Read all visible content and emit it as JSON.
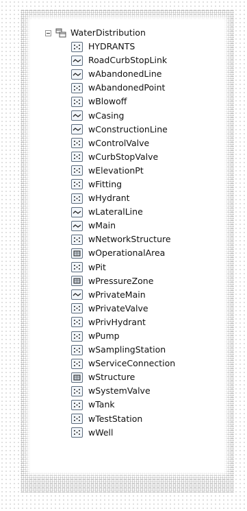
{
  "tree": {
    "root": {
      "label": "WaterDistribution",
      "expanded": true,
      "icon": "feature-dataset-icon"
    },
    "items": [
      {
        "label": "HYDRANTS",
        "icon": "point"
      },
      {
        "label": "RoadCurbStopLink",
        "icon": "line"
      },
      {
        "label": "wAbandonedLine",
        "icon": "line"
      },
      {
        "label": "wAbandonedPoint",
        "icon": "point"
      },
      {
        "label": "wBlowoff",
        "icon": "point"
      },
      {
        "label": "wCasing",
        "icon": "line"
      },
      {
        "label": "wConstructionLine",
        "icon": "line"
      },
      {
        "label": "wControlValve",
        "icon": "point"
      },
      {
        "label": "wCurbStopValve",
        "icon": "point"
      },
      {
        "label": "wElevationPt",
        "icon": "point"
      },
      {
        "label": "wFitting",
        "icon": "point"
      },
      {
        "label": "wHydrant",
        "icon": "point"
      },
      {
        "label": "wLateralLine",
        "icon": "line"
      },
      {
        "label": "wMain",
        "icon": "line"
      },
      {
        "label": "wNetworkStructure",
        "icon": "point"
      },
      {
        "label": "wOperationalArea",
        "icon": "polygon"
      },
      {
        "label": "wPit",
        "icon": "point"
      },
      {
        "label": "wPressureZone",
        "icon": "polygon"
      },
      {
        "label": "wPrivateMain",
        "icon": "line"
      },
      {
        "label": "wPrivateValve",
        "icon": "point"
      },
      {
        "label": "wPrivHydrant",
        "icon": "point"
      },
      {
        "label": "wPump",
        "icon": "point"
      },
      {
        "label": "wSamplingStation",
        "icon": "point"
      },
      {
        "label": "wServiceConnection",
        "icon": "point"
      },
      {
        "label": "wStructure",
        "icon": "polygon"
      },
      {
        "label": "wSystemValve",
        "icon": "point"
      },
      {
        "label": "wTank",
        "icon": "point"
      },
      {
        "label": "wTestStation",
        "icon": "point"
      },
      {
        "label": "wWell",
        "icon": "point"
      }
    ]
  }
}
